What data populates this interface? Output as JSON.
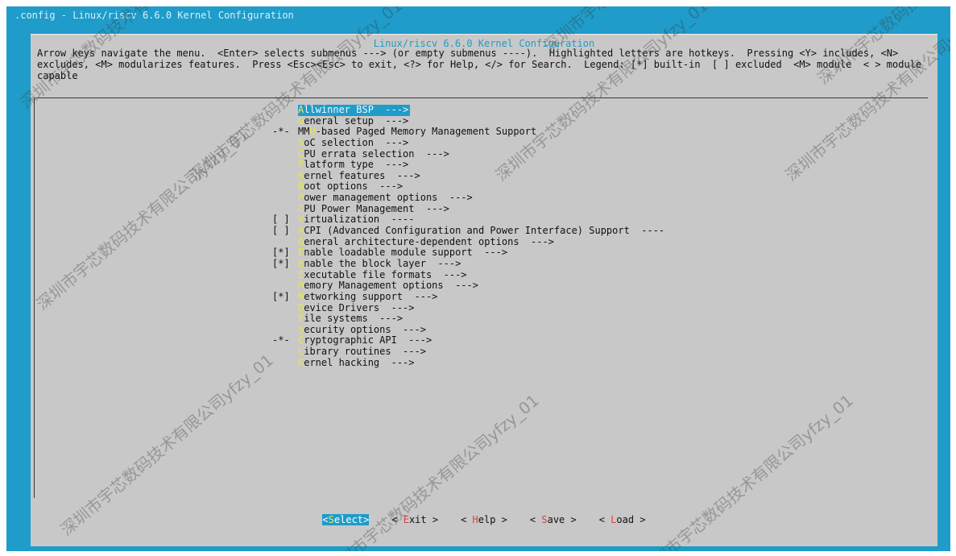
{
  "backtitle": ".config - Linux/riscv 6.6.0 Kernel Configuration",
  "dialog_title": "Linux/riscv 6.6.0 Kernel Configuration",
  "help_text": "Arrow keys navigate the menu.  <Enter> selects submenus ---> (or empty submenus ----).  Highlighted letters are hotkeys.  Pressing <Y> includes, <N>\nexcludes, <M> modularizes features.  Press <Esc><Esc> to exit, <?> for Help, </> for Search.  Legend: [*] built-in  [ ] excluded  <M> module  < > module\ncapable",
  "menu": {
    "items": [
      {
        "prefix": "   ",
        "hot": "A",
        "rest": "llwinner BSP  --->",
        "selected": true
      },
      {
        "prefix": "   ",
        "hot": "G",
        "rest": "eneral setup  --->",
        "selected": false
      },
      {
        "prefix": "-*-",
        "hot": "MMU",
        "rest": "-based Paged Memory Management Support",
        "selected": false,
        "hot_pos": "U"
      },
      {
        "prefix": "   ",
        "hot": "S",
        "rest": "oC selection  --->",
        "selected": false
      },
      {
        "prefix": "   ",
        "hot": "C",
        "rest": "PU errata selection  --->",
        "selected": false
      },
      {
        "prefix": "   ",
        "hot": "P",
        "rest": "latform type  --->",
        "selected": false
      },
      {
        "prefix": "   ",
        "hot": "K",
        "rest": "ernel features  --->",
        "selected": false
      },
      {
        "prefix": "   ",
        "hot": "B",
        "rest": "oot options  --->",
        "selected": false
      },
      {
        "prefix": "   ",
        "hot": "P",
        "rest": "ower management options  --->",
        "selected": false
      },
      {
        "prefix": "   ",
        "hot": "C",
        "rest": "PU Power Management  --->",
        "selected": false
      },
      {
        "prefix": "[ ]",
        "hot": "V",
        "rest": "irtualization  ----",
        "selected": false
      },
      {
        "prefix": "[ ]",
        "hot": "A",
        "rest": "CPI (Advanced Configuration and Power Interface) Support  ----",
        "selected": false
      },
      {
        "prefix": "   ",
        "hot": "G",
        "rest": "eneral architecture-dependent options  --->",
        "selected": false
      },
      {
        "prefix": "[*]",
        "hot": "E",
        "rest": "nable loadable module support  --->",
        "selected": false
      },
      {
        "prefix": "[*]",
        "hot": "E",
        "rest": "nable the block layer  --->",
        "selected": false
      },
      {
        "prefix": "   ",
        "hot": "E",
        "rest": "xecutable file formats  --->",
        "selected": false
      },
      {
        "prefix": "   ",
        "hot": "M",
        "rest": "emory Management options  --->",
        "selected": false
      },
      {
        "prefix": "[*]",
        "hot": "N",
        "rest": "etworking support  --->",
        "selected": false
      },
      {
        "prefix": "   ",
        "hot": "D",
        "rest": "evice Drivers  --->",
        "selected": false
      },
      {
        "prefix": "   ",
        "hot": "F",
        "rest": "ile systems  --->",
        "selected": false
      },
      {
        "prefix": "   ",
        "hot": "S",
        "rest": "ecurity options  --->",
        "selected": false
      },
      {
        "prefix": "-*-",
        "hot": "C",
        "rest": "ryptographic API  --->",
        "selected": false
      },
      {
        "prefix": "   ",
        "hot": "L",
        "rest": "ibrary routines  --->",
        "selected": false
      },
      {
        "prefix": "   ",
        "hot": "K",
        "rest": "ernel hacking  --->",
        "selected": false
      }
    ]
  },
  "buttons": [
    {
      "name": "select-button",
      "open": "<",
      "acc": "S",
      "rest": "elect",
      "close": ">",
      "selected": true
    },
    {
      "name": "exit-button",
      "open": "< ",
      "acc": "E",
      "rest": "xit",
      "close": " >",
      "selected": false
    },
    {
      "name": "help-button",
      "open": "< ",
      "acc": "H",
      "rest": "elp",
      "close": " >",
      "selected": false
    },
    {
      "name": "save-button",
      "open": "< ",
      "acc": "S",
      "rest": "ave",
      "close": " >",
      "selected": false
    },
    {
      "name": "load-button",
      "open": "< ",
      "acc": "L",
      "rest": "oad",
      "close": " >",
      "selected": false
    }
  ],
  "watermark": [
    "深圳市宇芯数码技术有限公司yfzy_01"
  ],
  "colors": {
    "terminal_bg": "#1f9cc9",
    "dialog_bg": "#c8c8c8",
    "hotkey": "#e6e647",
    "button_accel": "#d34343"
  }
}
